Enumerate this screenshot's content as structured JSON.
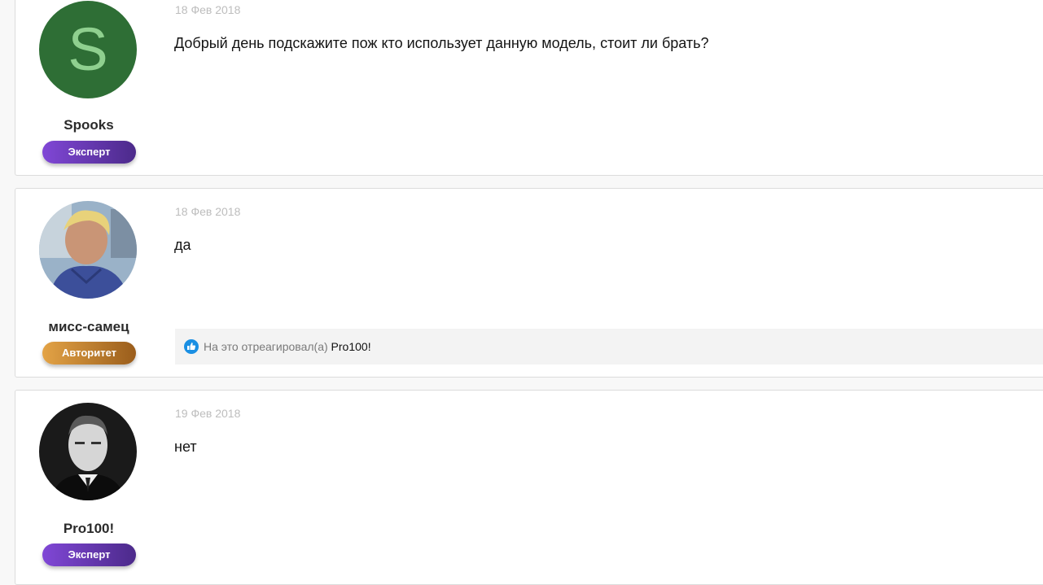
{
  "posts": [
    {
      "date": "18 Фев 2018",
      "text": "Добрый день подскажите пож кто использует данную модель, стоит ли брать?",
      "author": {
        "name": "Spooks",
        "avatar_letter": "S",
        "avatar_bg": "#2e6e35",
        "badge": "Эксперт"
      }
    },
    {
      "date": "18 Фев 2018",
      "text": "да",
      "author": {
        "name": "мисс-самец",
        "avatar_icon": "user-photo",
        "badge": "Авторитет"
      },
      "reactions": {
        "prefix": "На это отреагировал(а)",
        "user": "Pro100!",
        "icon": "like-icon"
      }
    },
    {
      "date": "19 Фев 2018",
      "text": "нет",
      "author": {
        "name": "Pro100!",
        "avatar_icon": "user-photo",
        "badge": "Эксперт"
      }
    }
  ],
  "colors": {
    "badge_expert": "#6a3bb8",
    "badge_authority": "#c98b2f",
    "date": "#bdbdbd",
    "like_blue": "#1a8fe3"
  }
}
